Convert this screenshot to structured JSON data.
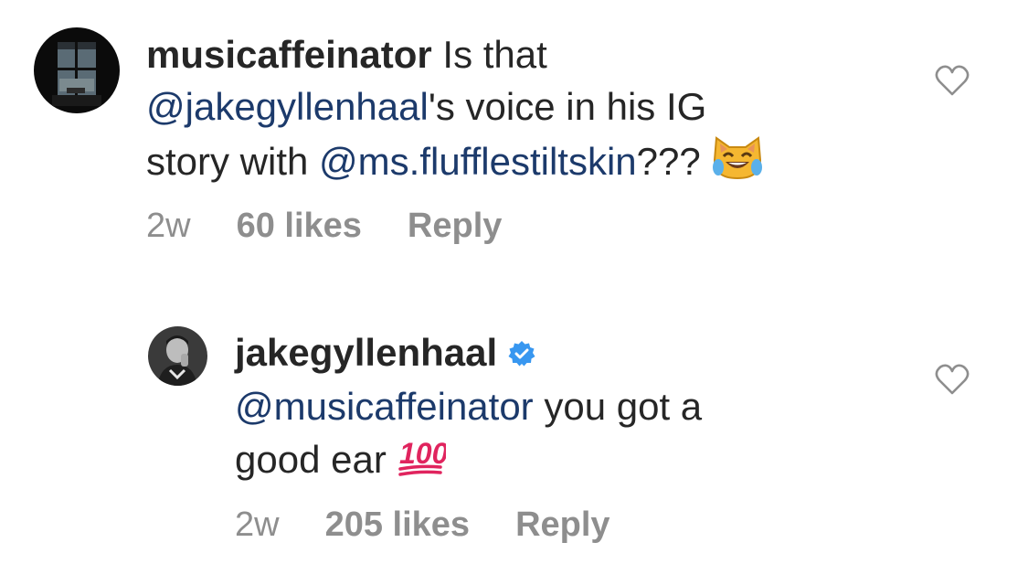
{
  "comments": [
    {
      "username": "musicaffeinator",
      "text_1": " Is that",
      "mention_1": "@jakegyllenhaal",
      "text_2": "'s voice in his IG",
      "text_3": "story with ",
      "mention_2": "@ms.flufflestiltskin",
      "text_4": "??? ",
      "emoji": "cat-face-with-tears-of-joy",
      "time": "2w",
      "likes": "60 likes",
      "reply": "Reply",
      "like_icon": "heart-outline-icon"
    },
    {
      "username": "jakegyllenhaal",
      "verified": true,
      "mention_1": "@musicaffeinator",
      "text_1": " you got a",
      "text_2": "good ear ",
      "emoji": "hundred-points",
      "emoji_text": "100",
      "time": "2w",
      "likes": "205 likes",
      "reply": "Reply",
      "like_icon": "heart-outline-icon"
    }
  ],
  "colors": {
    "text": "#262626",
    "mention": "#1c3a6b",
    "meta": "#8e8e8e",
    "verified": "#3897f0",
    "hundred": "#e0245e"
  }
}
